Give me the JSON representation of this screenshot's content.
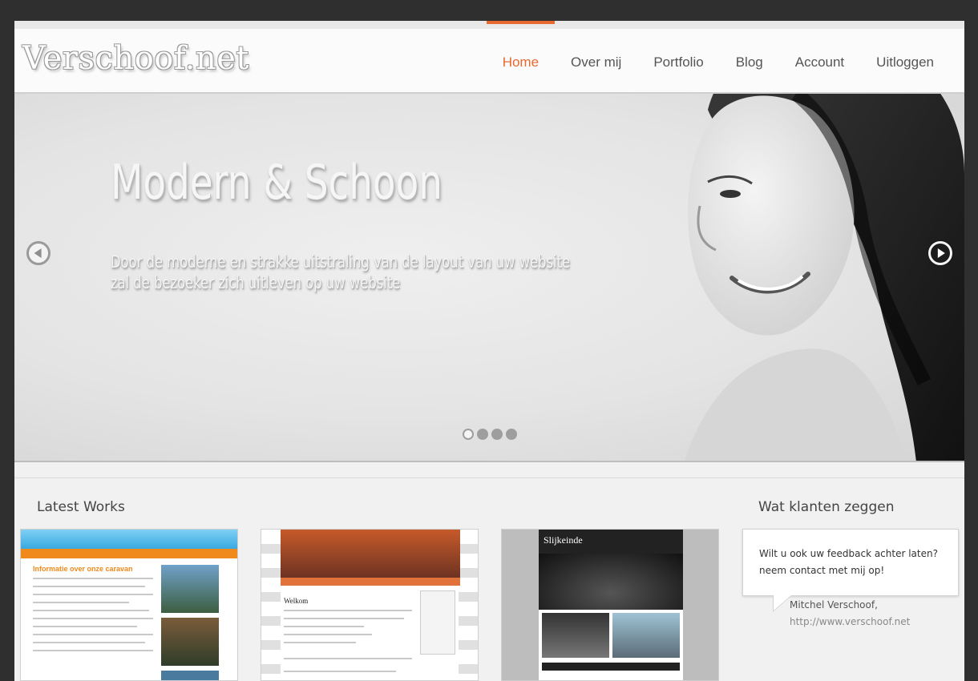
{
  "header": {
    "logo": "Verschoof.net",
    "nav": [
      {
        "label": "Home",
        "active": true
      },
      {
        "label": "Over mij",
        "active": false
      },
      {
        "label": "Portfolio",
        "active": false
      },
      {
        "label": "Blog",
        "active": false
      },
      {
        "label": "Account",
        "active": false
      },
      {
        "label": "Uitloggen",
        "active": false
      }
    ]
  },
  "slider": {
    "title": "Modern & Schoon",
    "text": "Door de moderne en strakke uitstraling van de layout van uw website zal de bezoeker zich uitleven op uw website",
    "prev_icon": "chevron-left-icon",
    "next_icon": "chevron-right-icon",
    "slide_count": 4,
    "active_slide": 1
  },
  "works": {
    "title": "Latest Works",
    "items": [
      {
        "thumb_label": "Informatie over onze caravan"
      },
      {
        "thumb_label": "Welkom"
      },
      {
        "thumb_label": "Slijkeinde"
      }
    ]
  },
  "testimonials": {
    "title": "Wat klanten zeggen",
    "quote": "Wilt u ook uw feedback achter laten? neem contact met mij op!",
    "author": "Mitchel Verschoof,",
    "url": "http://www.verschoof.net"
  },
  "colors": {
    "accent": "#e8692f",
    "background": "#2f2f2f",
    "page": "#f1f1f1"
  }
}
